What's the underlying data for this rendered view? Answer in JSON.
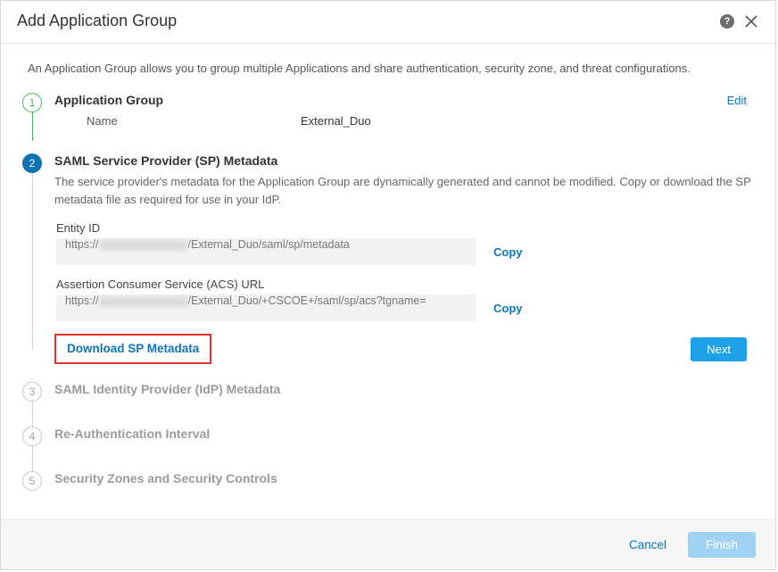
{
  "header": {
    "title": "Add Application Group"
  },
  "intro": "An Application Group allows you to group multiple Applications and share authentication, security zone, and threat configurations.",
  "steps": {
    "s1": {
      "num": "1",
      "title": "Application Group",
      "name_label": "Name",
      "name_value": "External_Duo",
      "edit": "Edit"
    },
    "s2": {
      "num": "2",
      "title": "SAML Service Provider (SP) Metadata",
      "desc": "The service provider's metadata for the Application Group are dynamically generated and cannot be modified. Copy or download the SP metadata file as required for use in your IdP.",
      "entity_label": "Entity ID",
      "entity_prefix": "https://",
      "entity_suffix": "/External_Duo/saml/sp/metadata",
      "acs_label": "Assertion Consumer Service (ACS) URL",
      "acs_prefix": "https://",
      "acs_suffix": "/External_Duo/+CSCOE+/saml/sp/acs?tgname=",
      "copy": "Copy",
      "download": "Download SP Metadata",
      "next": "Next"
    },
    "s3": {
      "num": "3",
      "title": "SAML Identity Provider (IdP) Metadata"
    },
    "s4": {
      "num": "4",
      "title": "Re-Authentication Interval"
    },
    "s5": {
      "num": "5",
      "title": "Security Zones and Security Controls"
    }
  },
  "footer": {
    "cancel": "Cancel",
    "finish": "Finish"
  }
}
